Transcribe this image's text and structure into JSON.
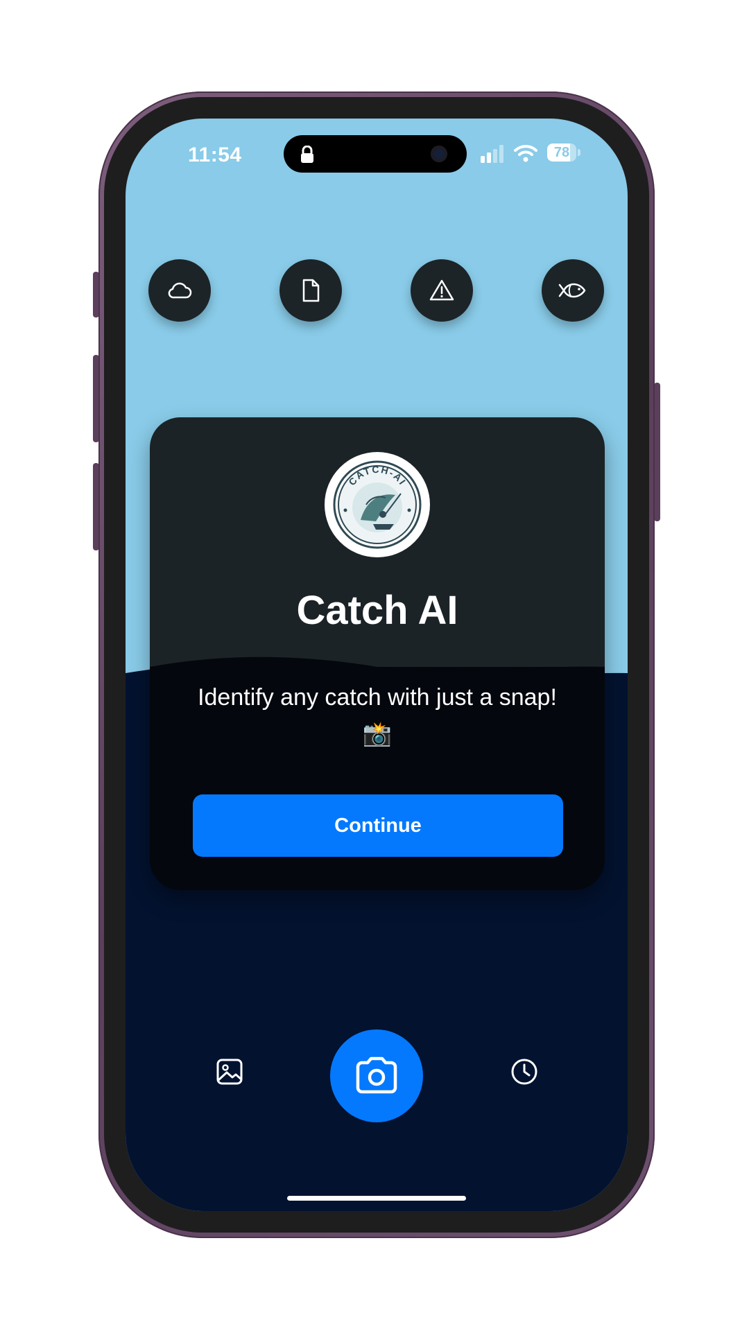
{
  "status_bar": {
    "time": "11:54",
    "battery": "78"
  },
  "top_buttons": [
    {
      "icon": "cloud-icon"
    },
    {
      "icon": "document-icon"
    },
    {
      "icon": "warning-icon"
    },
    {
      "icon": "fish-icon"
    }
  ],
  "card": {
    "logo_text": "CATCH-AI",
    "title": "Catch AI",
    "tagline": "Identify any catch with just a snap! 📸",
    "continue_label": "Continue"
  },
  "bottom_bar": {
    "left_icon": "gallery-icon",
    "center_icon": "camera-icon",
    "right_icon": "history-clock-icon"
  },
  "colors": {
    "sky": "#89cbe8",
    "sea": "#03122f",
    "accent": "#0479fe",
    "card_top": "#1b2327",
    "card_bottom": "#04070d",
    "icon_button": "#1c2428"
  }
}
